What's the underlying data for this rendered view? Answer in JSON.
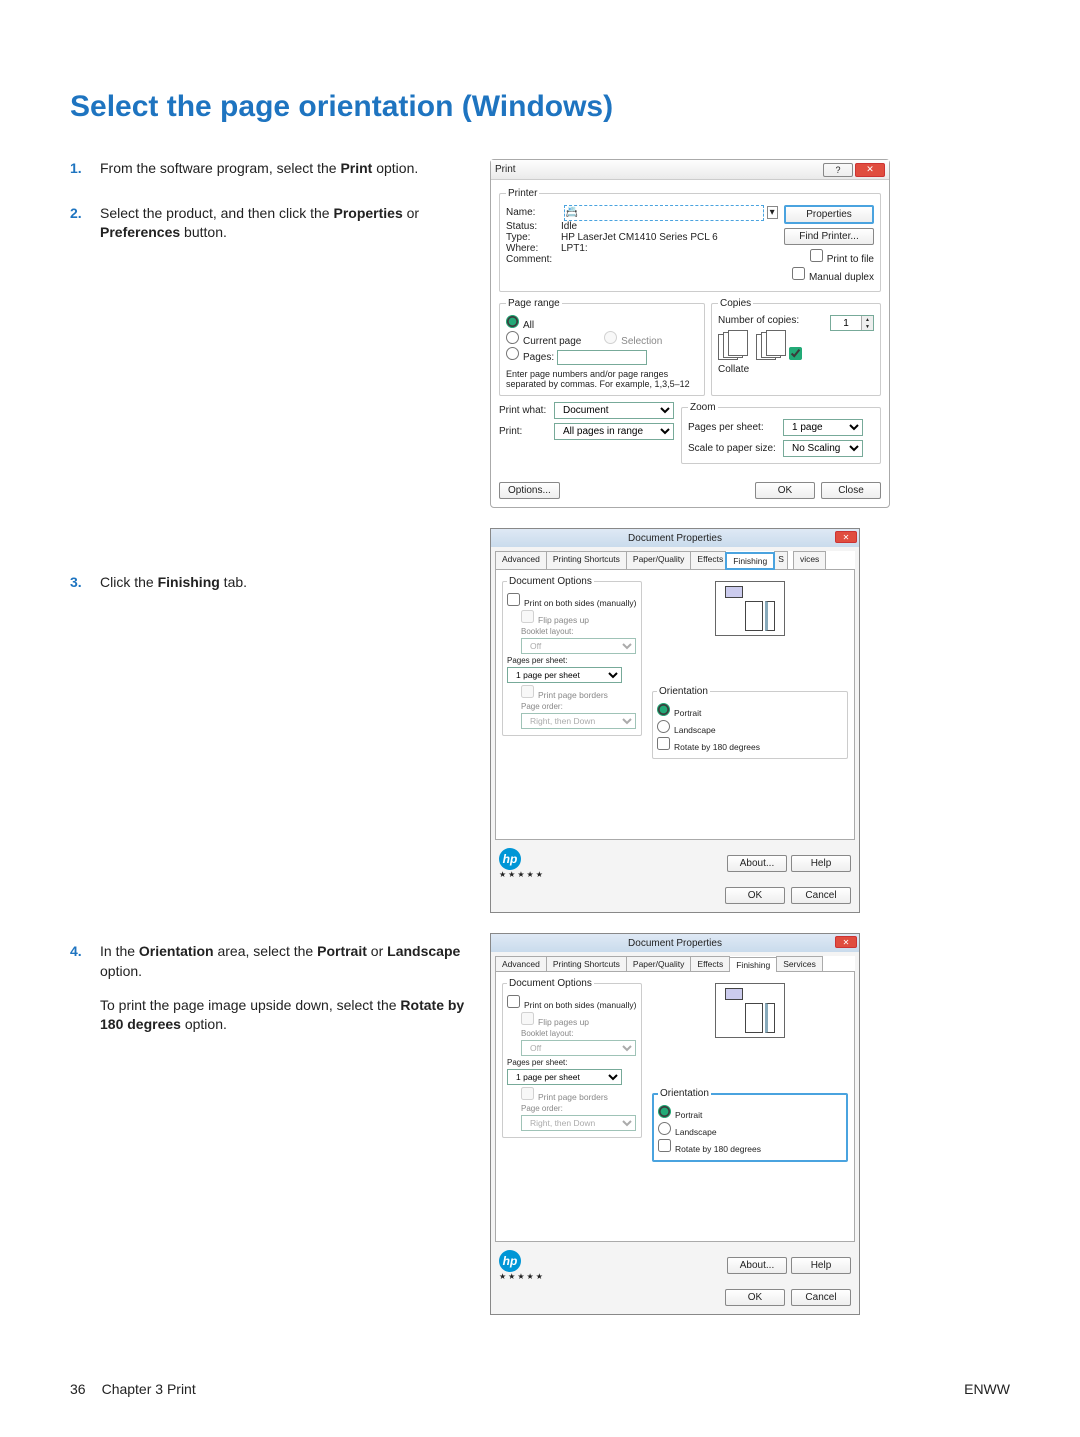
{
  "heading": "Select the page orientation (Windows)",
  "steps": {
    "s1": {
      "pre": "From the software program, select the ",
      "bold": "Print",
      "post": " option."
    },
    "s2": {
      "pre": "Select the product, and then click the ",
      "bold": "Properties",
      "mid": " or ",
      "bold2": "Preferences",
      "post": " button."
    },
    "s3": {
      "pre": "Click the ",
      "bold": "Finishing",
      "post": " tab."
    },
    "s4": {
      "pre": "In the ",
      "bold": "Orientation",
      "mid": " area, select the ",
      "bold2": "Portrait",
      "mid2": " or ",
      "bold3": "Landscape",
      "post": " option."
    },
    "s4b": {
      "pre": "To print the page image upside down, select the ",
      "bold": "Rotate by 180 degrees",
      "post": " option."
    }
  },
  "print_dlg": {
    "title": "Print",
    "printer_legend": "Printer",
    "name_lbl": "Name:",
    "status_lbl": "Status:",
    "status_val": "Idle",
    "type_lbl": "Type:",
    "type_val": "HP LaserJet CM1410 Series PCL 6",
    "where_lbl": "Where:",
    "where_val": "LPT1:",
    "comment_lbl": "Comment:",
    "btn_properties": "Properties",
    "btn_find": "Find Printer...",
    "ck_tofile": "Print to file",
    "ck_manual": "Manual duplex",
    "range_legend": "Page range",
    "r_all": "All",
    "r_cur": "Current page",
    "r_sel": "Selection",
    "r_pages": "Pages:",
    "range_hint": "Enter page numbers and/or page ranges separated by commas. For example, 1,3,5–12",
    "copies_legend": "Copies",
    "num_copies_lbl": "Number of copies:",
    "num_copies": "1",
    "ck_collate": "Collate",
    "printwhat_lbl": "Print what:",
    "printwhat": "Document",
    "print_lbl": "Print:",
    "print_val": "All pages in range",
    "zoom_legend": "Zoom",
    "pps_lbl": "Pages per sheet:",
    "pps": "1 page",
    "scale_lbl": "Scale to paper size:",
    "scale": "No Scaling",
    "btn_options": "Options...",
    "btn_ok": "OK",
    "btn_close": "Close"
  },
  "docprops": {
    "title": "Document Properties",
    "tabs": {
      "advanced": "Advanced",
      "shortcuts": "Printing Shortcuts",
      "paper": "Paper/Quality",
      "effects": "Effects",
      "finishing": "Finishing",
      "services": "Services",
      "s_prefix": "S",
      "s_suffix": "vices"
    },
    "docopt_legend": "Document Options",
    "ck_bothsides": "Print on both sides (manually)",
    "ck_flip": "Flip pages up",
    "booklet_lbl": "Booklet layout:",
    "booklet_val": "Off",
    "pps_lbl": "Pages per sheet:",
    "pps_val": "1 page per sheet",
    "ck_borders": "Print page borders",
    "order_lbl": "Page order:",
    "order_val": "Right, then Down",
    "orient_legend": "Orientation",
    "r_portrait": "Portrait",
    "r_landscape": "Landscape",
    "ck_rotate": "Rotate by 180 degrees",
    "btn_about": "About...",
    "btn_help": "Help",
    "btn_ok": "OK",
    "btn_cancel": "Cancel"
  },
  "footer": {
    "page": "36",
    "chapter": "Chapter 3   Print",
    "enww": "ENWW"
  }
}
